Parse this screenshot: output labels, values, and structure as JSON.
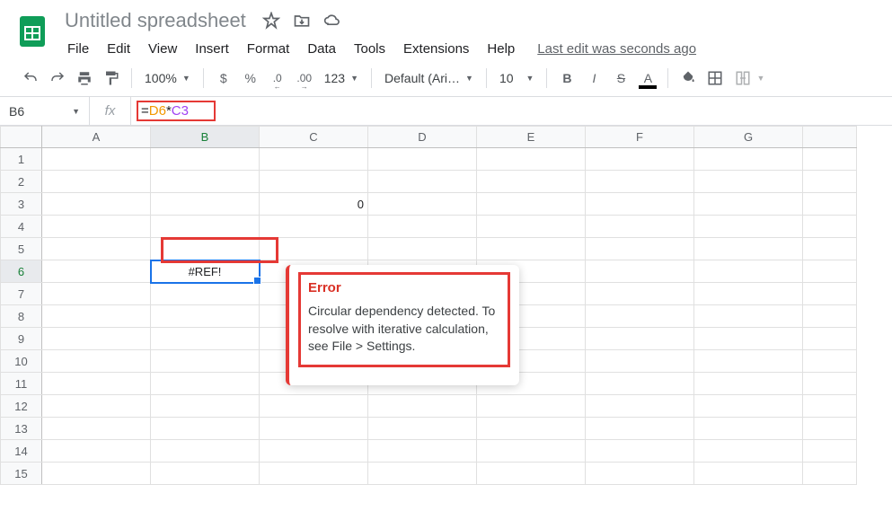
{
  "doc_title": "Untitled spreadsheet",
  "menubar": [
    "File",
    "Edit",
    "View",
    "Insert",
    "Format",
    "Data",
    "Tools",
    "Extensions",
    "Help"
  ],
  "last_edit": "Last edit was seconds ago",
  "toolbar": {
    "zoom": "100%",
    "currency": "$",
    "percent": "%",
    "dec_dec": ".0",
    "dec_inc": ".00",
    "num_fmt": "123",
    "font": "Default (Ari…",
    "font_size": "10",
    "text_color_letter": "A"
  },
  "formula_bar": {
    "name_box": "B6",
    "fx": "fx",
    "eq": "=",
    "ref1": "D6",
    "op": "*",
    "ref2": "C3"
  },
  "columns": [
    "A",
    "B",
    "C",
    "D",
    "E",
    "F",
    "G"
  ],
  "rows": [
    "1",
    "2",
    "3",
    "4",
    "5",
    "6",
    "7",
    "8",
    "9",
    "10",
    "11",
    "12",
    "13",
    "14",
    "15"
  ],
  "cells": {
    "C3": "0",
    "B6": "#REF!"
  },
  "selected_col": "B",
  "selected_row": "6",
  "tooltip": {
    "title": "Error",
    "body": "Circular dependency detected. To resolve with iterative calculation, see File > Settings."
  }
}
